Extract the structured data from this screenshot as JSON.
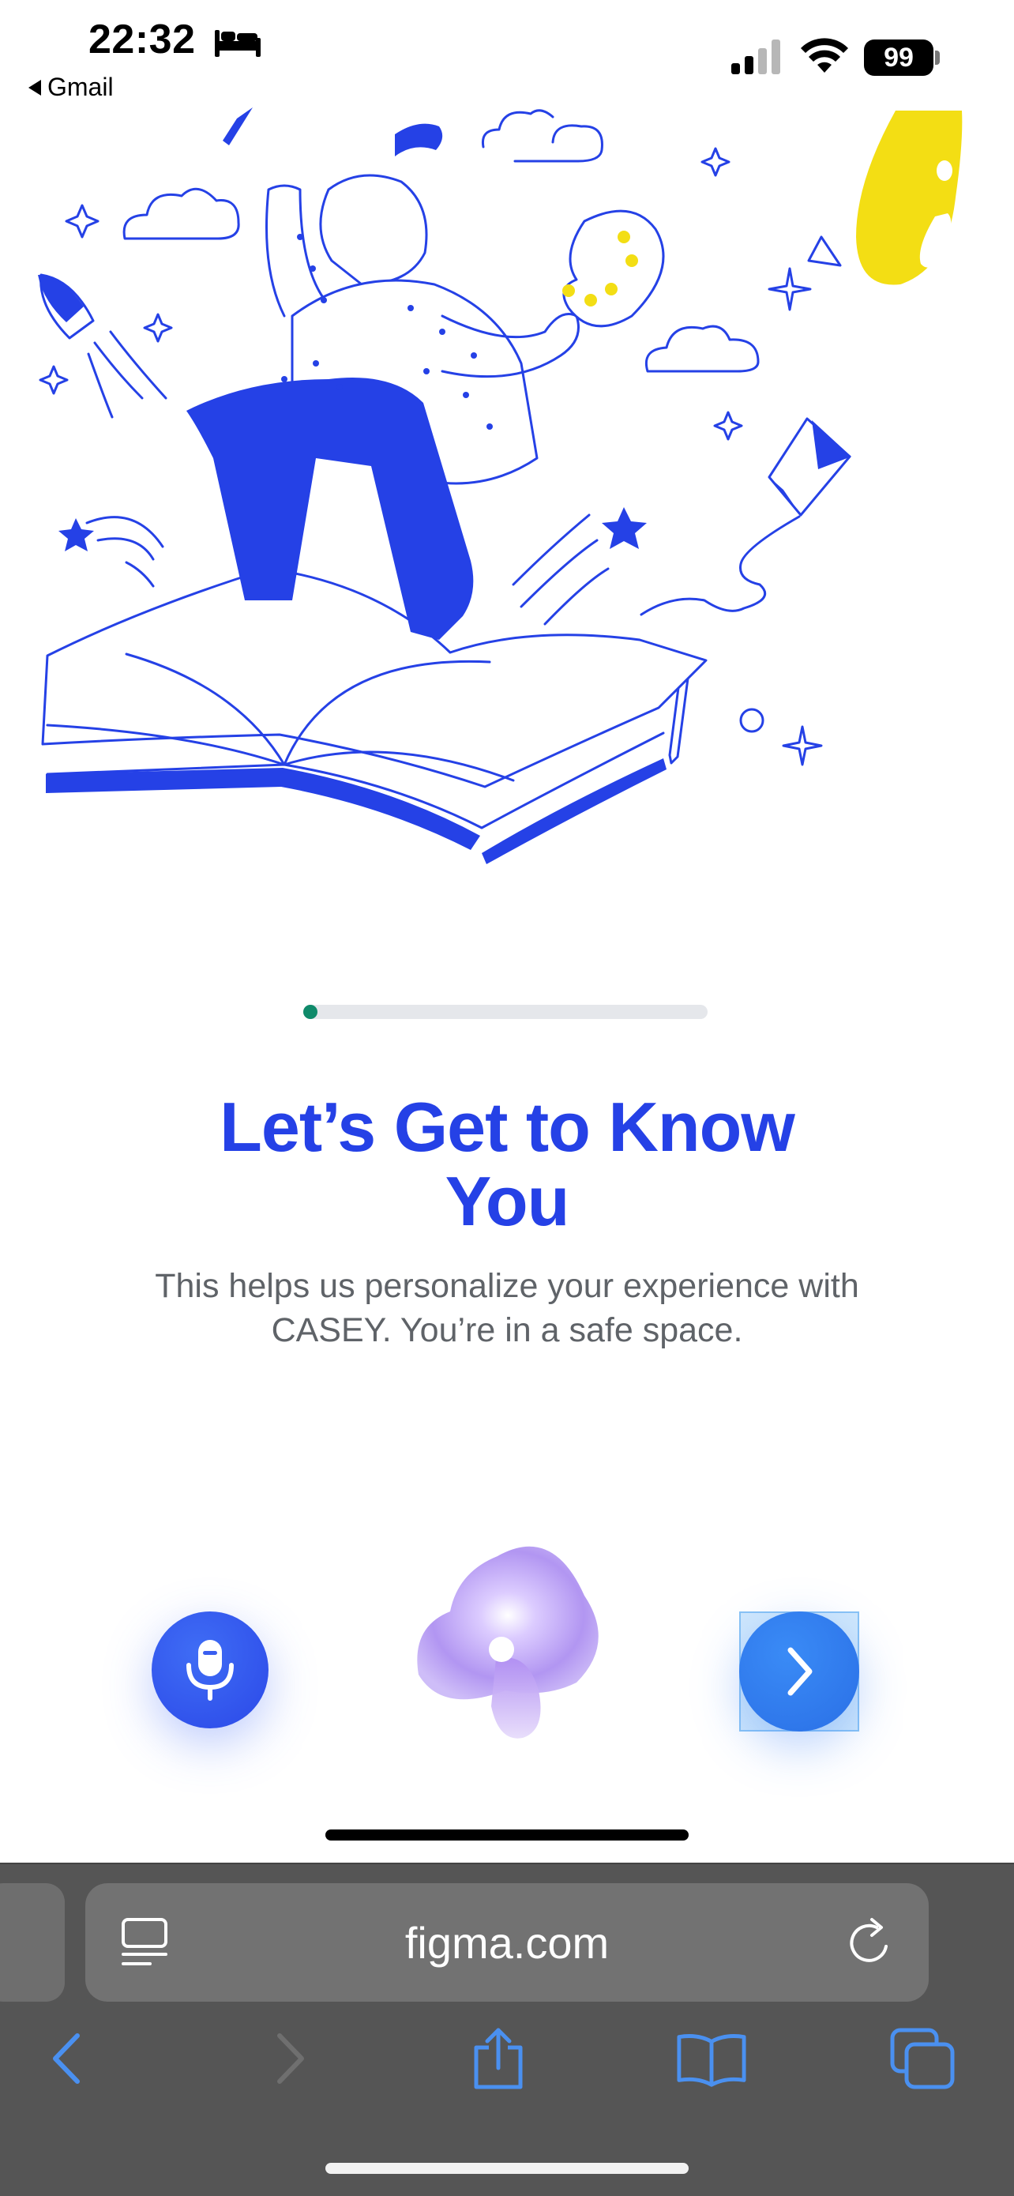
{
  "status_bar": {
    "time": "22:32",
    "back_app": "Gmail",
    "battery": "99",
    "icons": [
      "bed-icon",
      "signal-icon",
      "wifi-icon",
      "battery-icon"
    ]
  },
  "illustration": {
    "description_icon": "person-painting-on-book-illustration",
    "accent_colors": [
      "#2541e6",
      "#f3de14"
    ]
  },
  "onboarding": {
    "progress": 0.03,
    "title_line1": "Let’s Get to Know",
    "title_line2": "You",
    "subtitle_line1": "This helps us personalize your experience with",
    "subtitle_line2": "CASEY. You’re in a safe space."
  },
  "actions": {
    "mic_icon": "microphone-icon",
    "assistant_icon": "casey-orb-icon",
    "next_icon": "chevron-right-icon"
  },
  "browser": {
    "url": "figma.com",
    "toolbar": [
      "back",
      "forward",
      "share",
      "bookmarks",
      "tabs"
    ],
    "accent": "#4a90f0"
  }
}
